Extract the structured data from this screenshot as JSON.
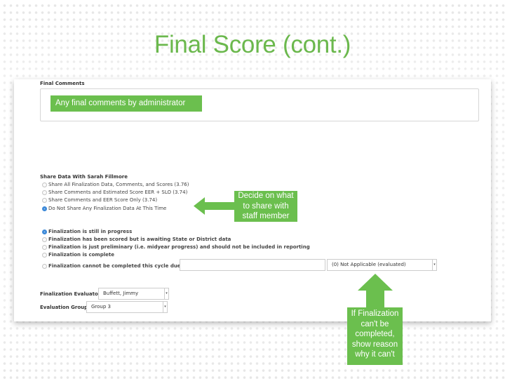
{
  "slide": {
    "title": "Final Score (cont.)",
    "accent_color": "#6bb84d"
  },
  "final_comments": {
    "label": "Final Comments",
    "value": ""
  },
  "share": {
    "label": "Share Data With Sarah Fillmore",
    "options": [
      {
        "label": "Share All Finalization Data, Comments, and Scores (3.76)",
        "selected": false
      },
      {
        "label": "Share Comments and Estimated Score EER + SLO (3.74)",
        "selected": false
      },
      {
        "label": "Share Comments and EER Score Only (3.74)",
        "selected": false
      },
      {
        "label": "Do Not Share Any Finalization Data At This Time",
        "selected": true
      }
    ]
  },
  "status": {
    "options": [
      {
        "label": "Finalization is still in progress",
        "selected": true
      },
      {
        "label": "Finalization has been scored but is awaiting State or District data",
        "selected": false
      },
      {
        "label": "Finalization is just preliminary (i.e. midyear progress) and should not be included in reporting",
        "selected": false
      },
      {
        "label": "Finalization is complete",
        "selected": false
      },
      {
        "label": "Finalization cannot be completed this cycle due to:",
        "selected": false
      }
    ],
    "reason_input_value": "",
    "reason_select_value": "(0) Not Applicable (evaluated)"
  },
  "evaluator": {
    "label": "Finalization Evaluator:",
    "value": "Buffett, Jimmy"
  },
  "group": {
    "label": "Evaluation Group:",
    "value": "Group 3"
  },
  "callouts": {
    "comments": "Any final comments by administrator",
    "share": [
      "Decide on what",
      "to share with",
      "staff member"
    ],
    "reason": [
      "If Finalization",
      "can't be",
      "completed,",
      "show reason",
      "why it can't"
    ]
  }
}
